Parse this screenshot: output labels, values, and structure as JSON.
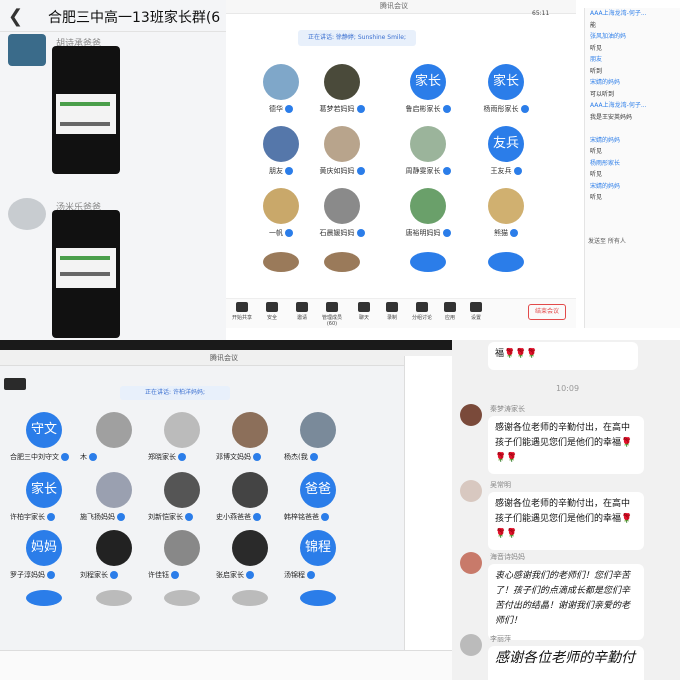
{
  "chat_top": {
    "title": "合肥三中高一13班家长群(6",
    "sender1": "胡诗承爸爸",
    "sender2": "汤米乐爸爸"
  },
  "meeting_top": {
    "window_title": "腾讯会议",
    "speaking": "正在讲话: 徐静婷; Sunshine Smile;",
    "time": "65:11",
    "participants": [
      {
        "name": "德华",
        "type": "photo",
        "color": "#7fa7c9"
      },
      {
        "name": "葛梦若妈妈",
        "type": "photo",
        "color": "#4a4a3a"
      },
      {
        "name": "鲁启彬家长",
        "type": "text",
        "label": "家长"
      },
      {
        "name": "杨雨彤家长",
        "type": "text",
        "label": "家长"
      },
      {
        "name": "朋友",
        "type": "photo",
        "color": "#5577aa"
      },
      {
        "name": "黄庆如妈妈",
        "type": "photo",
        "color": "#b8a48c"
      },
      {
        "name": "周静雯家长",
        "type": "photo",
        "color": "#9bb49b"
      },
      {
        "name": "王友兵",
        "type": "text",
        "label": "友兵"
      },
      {
        "name": "一帆",
        "type": "photo",
        "color": "#c9a86a"
      },
      {
        "name": "石晨媛妈妈",
        "type": "photo",
        "color": "#8a8a8a"
      },
      {
        "name": "唐裕明妈妈",
        "type": "photo",
        "color": "#6aa06a"
      },
      {
        "name": "熊猫",
        "type": "photo",
        "color": "#d0b070"
      }
    ],
    "toolbar": [
      "开始共享",
      "安全",
      "邀请",
      "管理成员(60)",
      "聊天",
      "录制",
      "分组讨论",
      "应用",
      "设置"
    ],
    "end_label": "结束会议",
    "chat_lines": [
      {
        "t": "AAA上海龙湾-何子...",
        "blue": true
      },
      {
        "t": "能",
        "blue": false
      },
      {
        "t": "张风加油的妈",
        "blue": true
      },
      {
        "t": "听见",
        "blue": false
      },
      {
        "t": "朋友",
        "blue": true
      },
      {
        "t": "听到",
        "blue": false
      },
      {
        "t": "宋婧的妈妈",
        "blue": true
      },
      {
        "t": "可以听到",
        "blue": false
      },
      {
        "t": "AAA上海龙湾-何子...",
        "blue": true
      },
      {
        "t": "我是王安英妈妈",
        "blue": false
      },
      {
        "t": "",
        "blue": false
      },
      {
        "t": "宋婧的妈妈",
        "blue": true
      },
      {
        "t": "听见",
        "blue": false
      },
      {
        "t": "杨雨彤家长",
        "blue": true
      },
      {
        "t": "听见",
        "blue": false
      },
      {
        "t": "宋婧的妈妈",
        "blue": true
      },
      {
        "t": "听见",
        "blue": false
      }
    ],
    "send_to": "发送至  所有人"
  },
  "meeting_bottom": {
    "window_title": "腾讯会议",
    "speaking": "正在讲话: 许柏洋妈妈;",
    "participants": [
      {
        "name": "合肥三中刘守文",
        "type": "text",
        "label": "守文"
      },
      {
        "name": "木",
        "type": "photo",
        "color": "#a0a0a0"
      },
      {
        "name": "郑晓家长",
        "type": "photo",
        "color": "#bbb"
      },
      {
        "name": "邓博文妈妈",
        "type": "photo",
        "color": "#8c6f5a"
      },
      {
        "name": "杨杰(我",
        "type": "photo",
        "color": "#7a8a9a"
      },
      {
        "name": "许柏宇家长",
        "type": "text",
        "label": "家长"
      },
      {
        "name": "施飞扬妈妈",
        "type": "photo",
        "color": "#9aa0b0"
      },
      {
        "name": "刘新恺家长",
        "type": "photo",
        "color": "#555"
      },
      {
        "name": "史小燕爸爸",
        "type": "photo",
        "color": "#444"
      },
      {
        "name": "韩梓铭爸爸",
        "type": "text",
        "label": "爸爸"
      },
      {
        "name": "罗子淳妈妈",
        "type": "text",
        "label": "妈妈"
      },
      {
        "name": "刘程家长",
        "type": "photo",
        "color": "#222"
      },
      {
        "name": "许佳钰",
        "type": "photo",
        "color": "#888"
      },
      {
        "name": "张启家长",
        "type": "photo",
        "color": "#2a2a2a"
      },
      {
        "name": "汤锦程",
        "type": "text",
        "label": "锦程"
      }
    ]
  },
  "chat_bottom": {
    "top_text": "福🌹🌹🌹",
    "time": "10:09",
    "messages": [
      {
        "sender": "秦梦涛家长",
        "text": "感谢各位老师的辛勤付出，在高中孩子们能遇见您们是他们的幸福🌹🌹🌹"
      },
      {
        "sender": "吴常明",
        "text": "感谢各位老师的辛勤付出，在高中孩子们能遇见您们是他们的幸福🌹🌹🌹"
      },
      {
        "sender": "海音诗妈妈",
        "text": "衷心感谢我们的老师们！您们辛苦了！孩子们的点滴成长都是您们辛苦付出的结晶！谢谢我们亲爱的老师们！"
      },
      {
        "sender": "李丽萍",
        "text": "感谢各位老师的辛勤付"
      }
    ]
  }
}
